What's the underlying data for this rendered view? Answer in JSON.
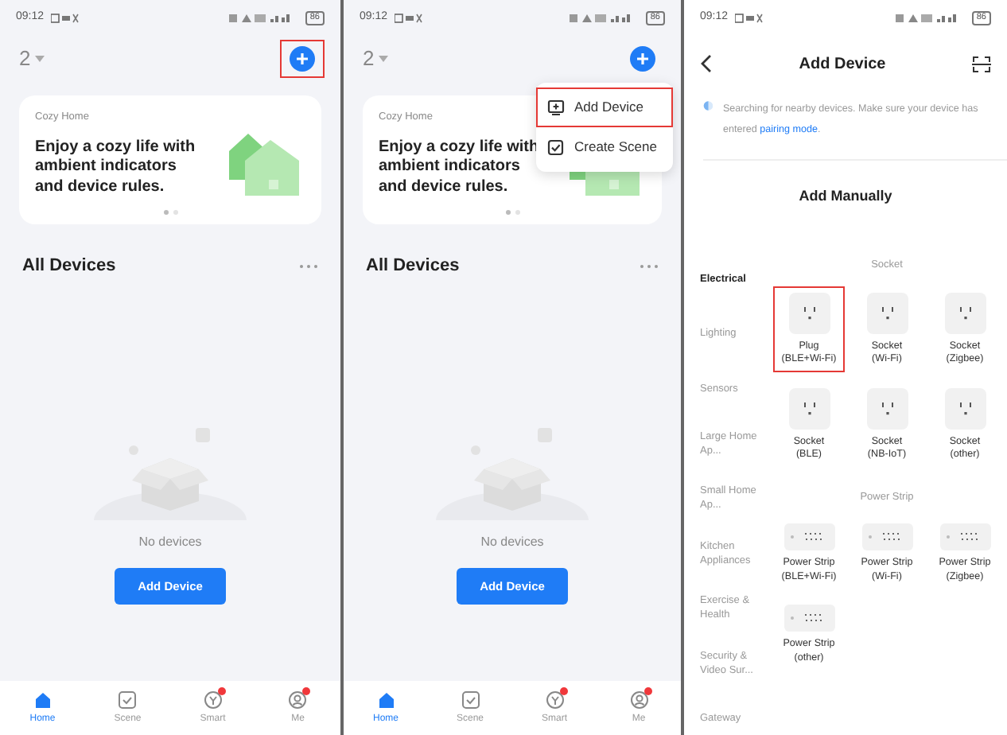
{
  "screens": [
    {
      "kind": "home",
      "status_bar": {
        "time": "09:12",
        "battery": "86"
      },
      "home_selector": "2",
      "add_button": {
        "highlighted": true
      },
      "banner": {
        "eyebrow": "Cozy Home",
        "headline": "Enjoy a cozy life with ambient indicators and device rules.",
        "pages": [
          {
            "selected": true
          },
          {
            "selected": false
          }
        ]
      },
      "section_title": "All Devices",
      "empty_text": "No devices",
      "empty_button": "Add Device",
      "tabs": [
        {
          "label": "Home",
          "kind": "home",
          "selected": true,
          "badge": false
        },
        {
          "label": "Scene",
          "kind": "scene",
          "selected": false,
          "badge": false
        },
        {
          "label": "Smart",
          "kind": "smart",
          "selected": false,
          "badge": true
        },
        {
          "label": "Me",
          "kind": "me",
          "selected": false,
          "badge": true
        }
      ]
    },
    {
      "kind": "home",
      "status_bar": {
        "time": "09:12",
        "battery": "86"
      },
      "home_selector": "2",
      "add_button": {
        "highlighted": false
      },
      "banner": {
        "eyebrow": "Cozy Home",
        "headline": "Enjoy a cozy life with ambient indicators and device rules.",
        "pages": [
          {
            "selected": true
          },
          {
            "selected": false
          }
        ]
      },
      "section_title": "All Devices",
      "empty_text": "No devices",
      "empty_button": "Add Device",
      "menu": [
        {
          "label": "Add Device",
          "kind": "add-device",
          "highlighted": true
        },
        {
          "label": "Create Scene",
          "kind": "scene",
          "highlighted": false
        }
      ],
      "tabs": [
        {
          "label": "Home",
          "kind": "home",
          "selected": true,
          "badge": false
        },
        {
          "label": "Scene",
          "kind": "scene",
          "selected": false,
          "badge": false
        },
        {
          "label": "Smart",
          "kind": "smart",
          "selected": false,
          "badge": true
        },
        {
          "label": "Me",
          "kind": "me",
          "selected": false,
          "badge": true
        }
      ]
    },
    {
      "kind": "add_device",
      "status_bar": {
        "time": "09:12",
        "battery": "86"
      },
      "title": "Add Device",
      "notice": {
        "text": "Searching for nearby devices. Make sure your device has entered",
        "link": "pairing mode",
        "suffix": "."
      },
      "section_title": "Add Manually",
      "categories": [
        {
          "label": "Electrical",
          "selected": true
        },
        {
          "label": "Lighting",
          "selected": false
        },
        {
          "label": "Sensors",
          "selected": false
        },
        {
          "label": "Large Home Ap...",
          "selected": false
        },
        {
          "label": "Small Home Ap...",
          "selected": false
        },
        {
          "label": "Kitchen Appliances",
          "selected": false
        },
        {
          "label": "Exercise & Health",
          "selected": false
        },
        {
          "label": "Security & Video Sur...",
          "selected": false
        },
        {
          "label": "Gateway",
          "selected": false
        }
      ],
      "groups": [
        {
          "title": "Socket",
          "devices": [
            {
              "name": "Plug",
              "variant": "(BLE+Wi-Fi)",
              "kind": "socket",
              "highlighted": true
            },
            {
              "name": "Socket",
              "variant": "(Wi-Fi)",
              "kind": "socket",
              "highlighted": false
            },
            {
              "name": "Socket",
              "variant": "(Zigbee)",
              "kind": "socket",
              "highlighted": false
            },
            {
              "name": "Socket",
              "variant": "(BLE)",
              "kind": "socket",
              "highlighted": false
            },
            {
              "name": "Socket",
              "variant": "(NB-IoT)",
              "kind": "socket",
              "highlighted": false
            },
            {
              "name": "Socket",
              "variant": "(other)",
              "kind": "socket",
              "highlighted": false
            }
          ]
        },
        {
          "title": "Power Strip",
          "devices": [
            {
              "name": "Power Strip",
              "variant": "(BLE+Wi-Fi)",
              "kind": "strip",
              "highlighted": false
            },
            {
              "name": "Power Strip",
              "variant": "(Wi-Fi)",
              "kind": "strip",
              "highlighted": false
            },
            {
              "name": "Power Strip",
              "variant": "(Zigbee)",
              "kind": "strip",
              "highlighted": false
            },
            {
              "name": "Power Strip",
              "variant": "(other)",
              "kind": "strip",
              "highlighted": false
            }
          ]
        }
      ]
    }
  ]
}
